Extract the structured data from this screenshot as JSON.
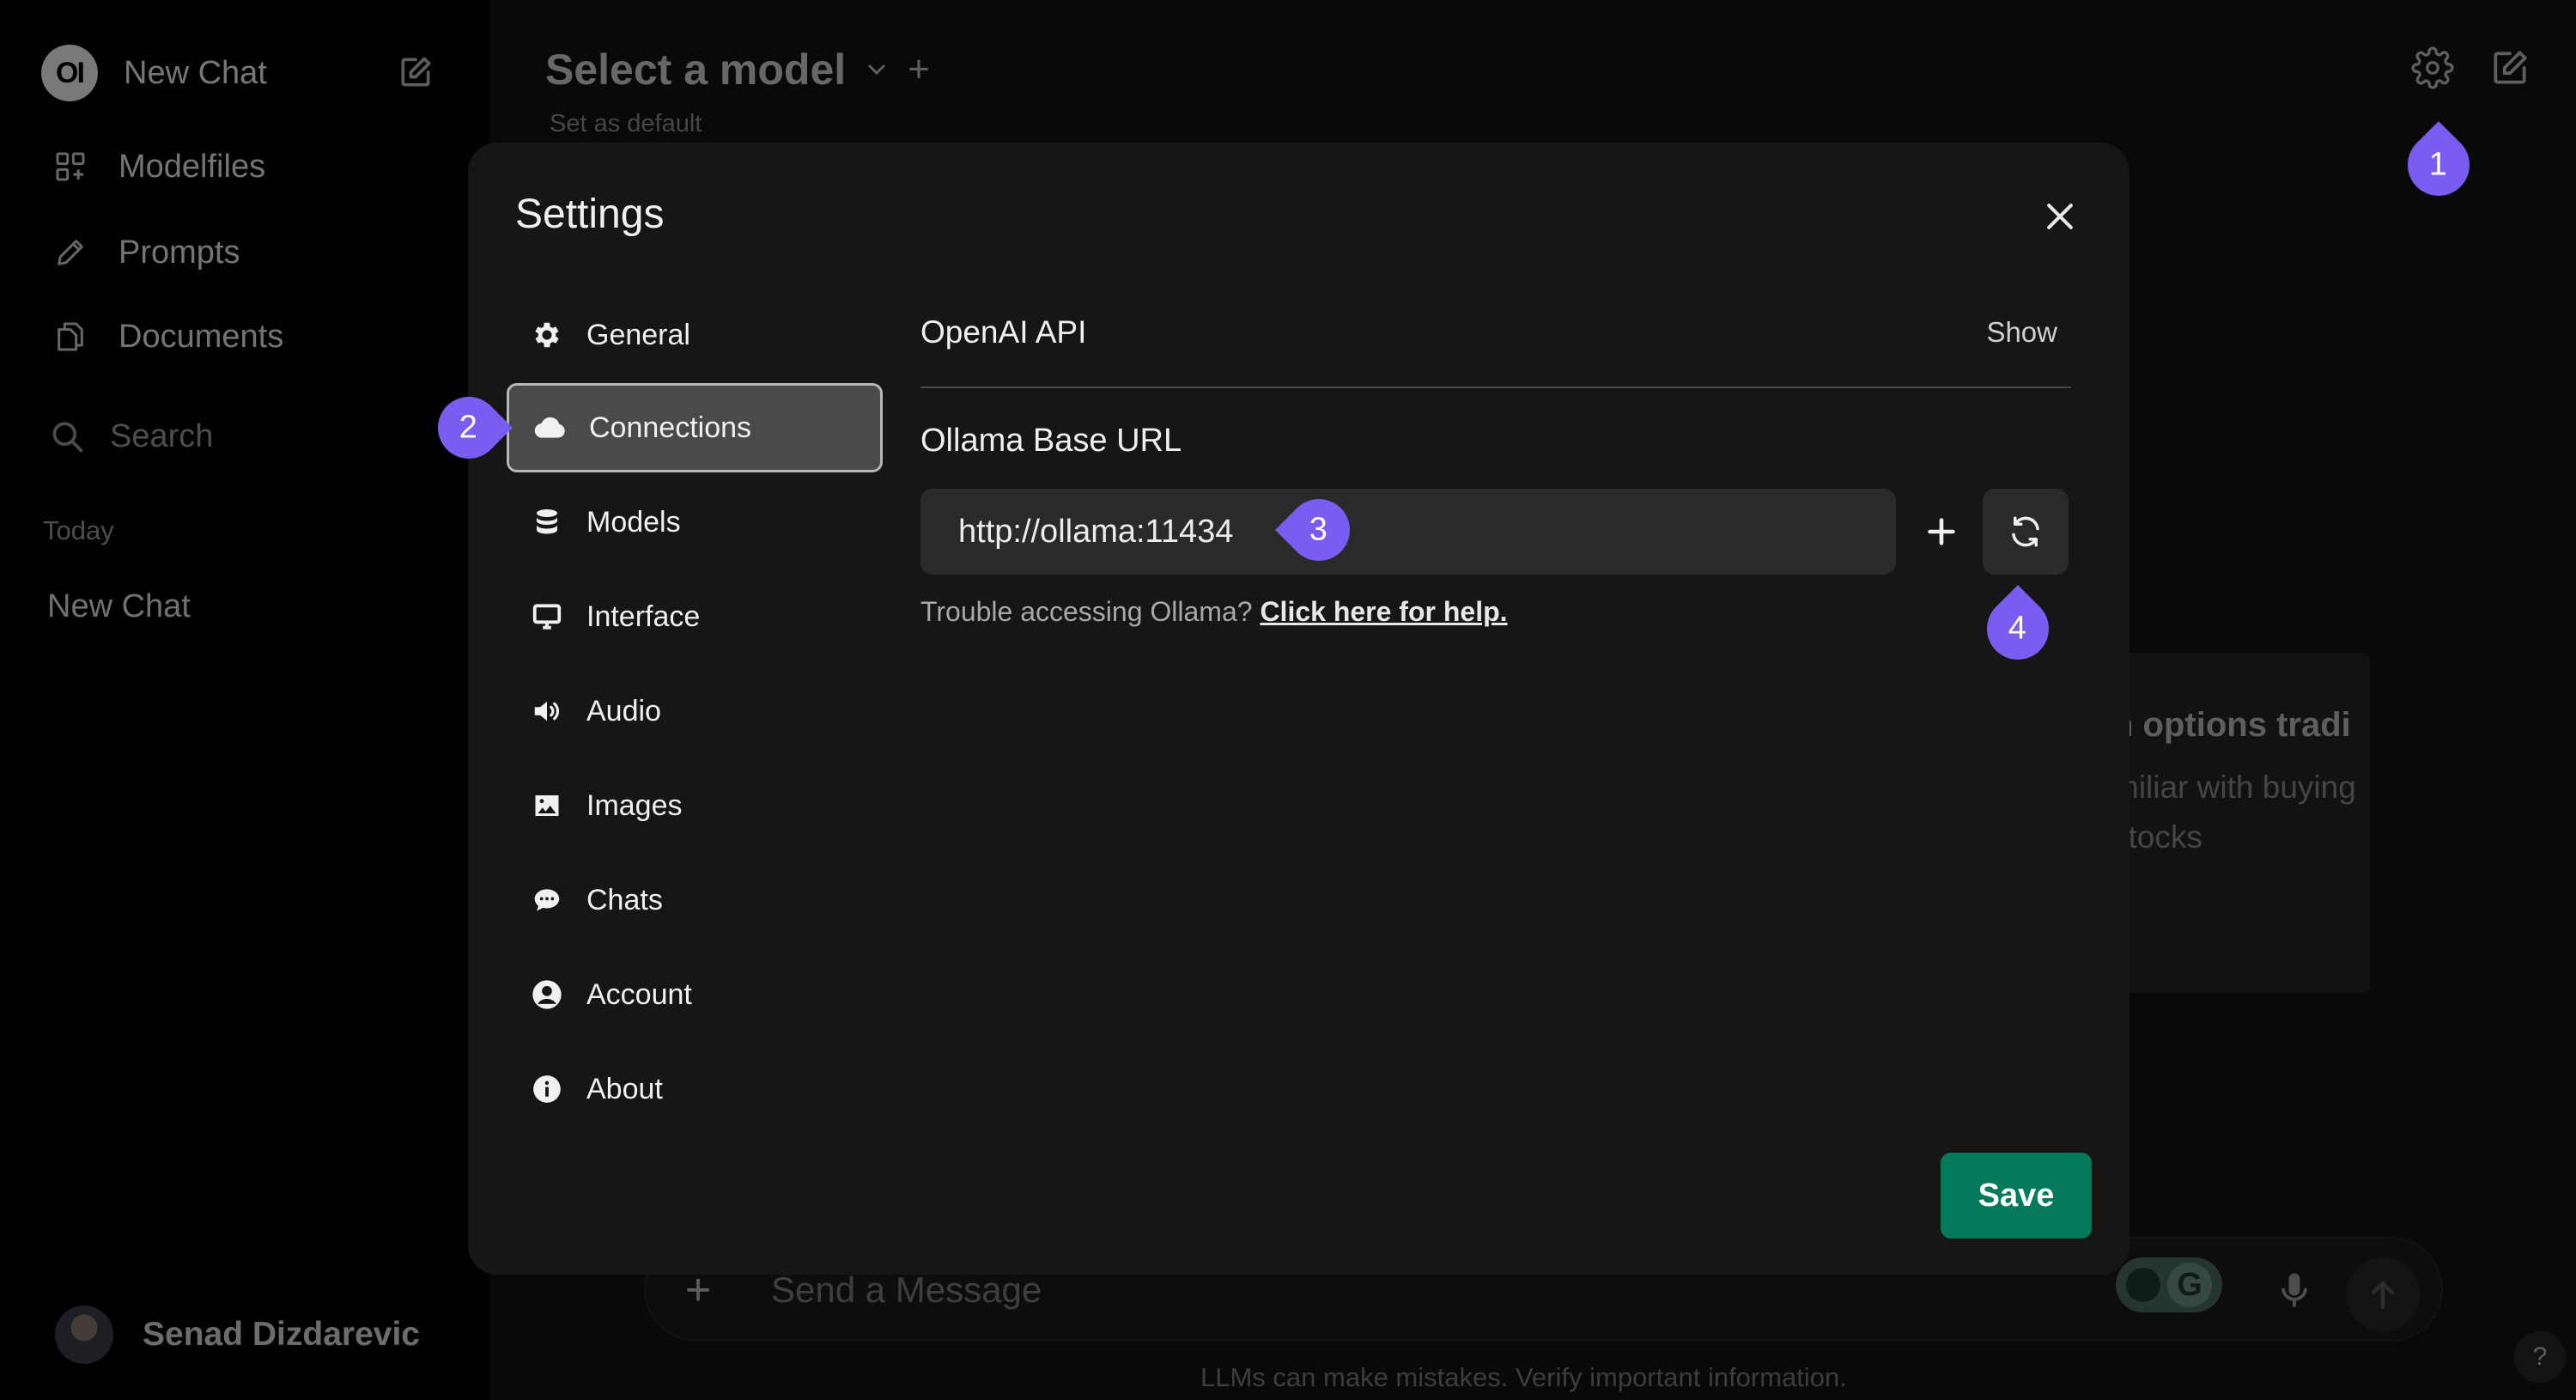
{
  "sidebar": {
    "brand_logo": "OI",
    "new_chat_label": "New Chat",
    "nav": [
      {
        "label": "Modelfiles",
        "icon": "grid-icon"
      },
      {
        "label": "Prompts",
        "icon": "pencil-icon"
      },
      {
        "label": "Documents",
        "icon": "documents-icon"
      }
    ],
    "search_placeholder": "Search",
    "section_label": "Today",
    "chats": [
      "New Chat"
    ],
    "user_name": "Senad Dizdarevic"
  },
  "header": {
    "model_title": "Select a model",
    "set_default": "Set as default"
  },
  "suggestion": {
    "title": "n options tradi",
    "subtitle_line1": "miliar with buying",
    "subtitle_line2": "stocks"
  },
  "composer": {
    "placeholder": "Send a Message",
    "disclaimer": "LLMs can make mistakes. Verify important information.",
    "help": "?"
  },
  "settings": {
    "title": "Settings",
    "tabs": [
      {
        "label": "General",
        "icon": "gear-icon"
      },
      {
        "label": "Connections",
        "icon": "cloud-icon",
        "active": true
      },
      {
        "label": "Models",
        "icon": "database-icon"
      },
      {
        "label": "Interface",
        "icon": "monitor-icon"
      },
      {
        "label": "Audio",
        "icon": "speaker-icon"
      },
      {
        "label": "Images",
        "icon": "image-icon"
      },
      {
        "label": "Chats",
        "icon": "chat-bubble-icon"
      },
      {
        "label": "Account",
        "icon": "user-circle-icon"
      },
      {
        "label": "About",
        "icon": "info-icon"
      }
    ],
    "connections": {
      "openai_label": "OpenAI API",
      "show_label": "Show",
      "ollama_label": "Ollama Base URL",
      "ollama_url": "http://ollama:11434",
      "help_text": "Trouble accessing Ollama?",
      "help_link": "Click here for help."
    },
    "save_label": "Save"
  },
  "markers": [
    "1",
    "2",
    "3",
    "4"
  ],
  "colors": {
    "accent_marker": "#7b5cf0",
    "save_button": "#057a5a",
    "modal_bg": "#161616",
    "sidebar_bg": "#030303"
  }
}
